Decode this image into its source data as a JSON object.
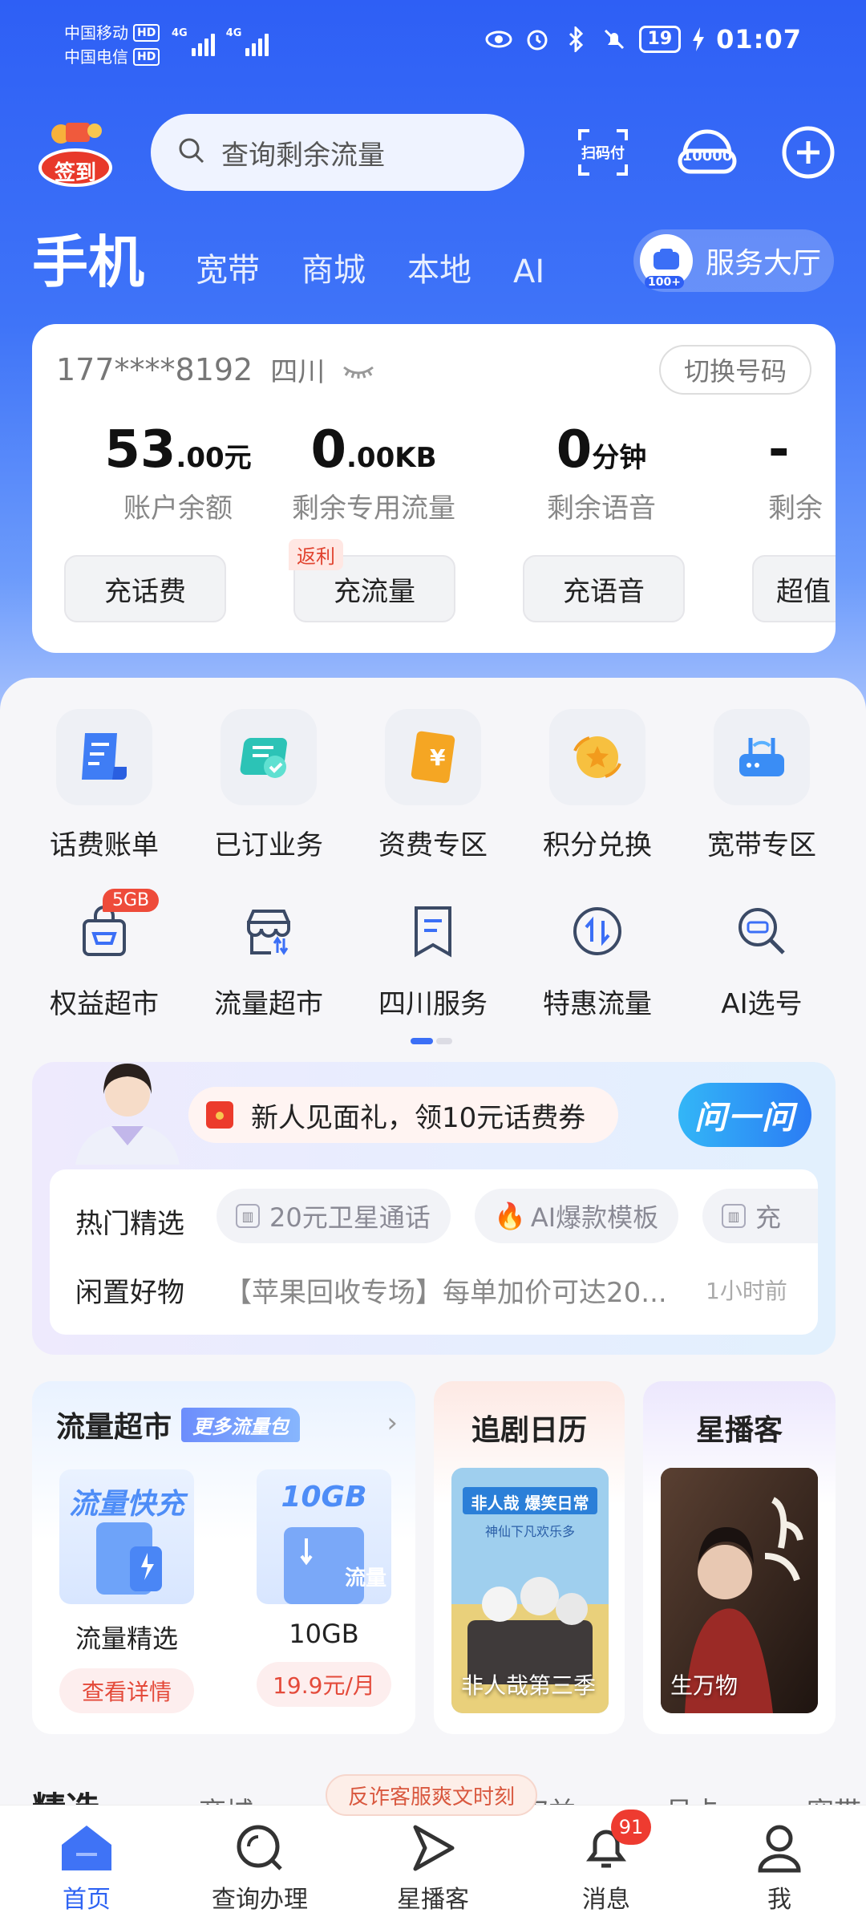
{
  "status_bar": {
    "carrier1": "中国移动",
    "carrier2": "中国电信",
    "hd": "HD",
    "net1": "4G",
    "net2": "4G",
    "battery": "19",
    "time": "01:07"
  },
  "header": {
    "signin_label": "签到",
    "search_placeholder": "查询剩余流量",
    "scan_pay_label": "扫码付",
    "hotline_label": "10000"
  },
  "tabs": [
    {
      "label": "手机",
      "active": true
    },
    {
      "label": "宽带"
    },
    {
      "label": "商城"
    },
    {
      "label": "本地"
    },
    {
      "label": "AI"
    }
  ],
  "service_hall": {
    "label": "服务大厅",
    "badge": "100+"
  },
  "account": {
    "phone": "177****8192",
    "province": "四川",
    "switch_label": "切换号码",
    "stats": [
      {
        "int": "53",
        "dec": ".00",
        "unit": "元",
        "label": "账户余额",
        "button": "充话费"
      },
      {
        "int": "0",
        "dec": ".00",
        "unit": "KB",
        "label": "剩余专用流量",
        "button": "充流量"
      },
      {
        "int": "0",
        "dec": "",
        "unit": "分钟",
        "label": "剩余语音",
        "button": "充语音"
      },
      {
        "int": "-",
        "dec": "",
        "unit": "",
        "label": "剩余",
        "button": "超值"
      }
    ],
    "rebate_tag": "返利"
  },
  "services_row1": [
    {
      "label": "话费账单",
      "icon": "bill-icon"
    },
    {
      "label": "已订业务",
      "icon": "subscribed-icon"
    },
    {
      "label": "资费专区",
      "icon": "tariff-icon"
    },
    {
      "label": "积分兑换",
      "icon": "points-icon"
    },
    {
      "label": "宽带专区",
      "icon": "router-icon"
    }
  ],
  "services_row2": [
    {
      "label": "权益超市",
      "icon": "shopping-bag-icon"
    },
    {
      "label": "流量超市",
      "icon": "data-store-icon"
    },
    {
      "label": "四川服务",
      "icon": "bookmark-doc-icon"
    },
    {
      "label": "特惠流量",
      "icon": "updown-arrows-icon"
    },
    {
      "label": "AI选号",
      "icon": "ai-search-icon"
    }
  ],
  "badge_5gb": "5GB",
  "promo": {
    "gift_text": "新人见面礼，领10元话费券",
    "ask_label": "问一问",
    "hot_label": "热门精选",
    "chips": [
      "20元卫星通话",
      "AI爆款模板",
      "充"
    ],
    "resale_label": "闲置好物",
    "resale_text": "【苹果回收专场】每单加价可达20...",
    "resale_time": "1小时前"
  },
  "flow_market": {
    "title": "流量超市",
    "more_tag": "更多流量包",
    "products": [
      {
        "image_text": "流量快充",
        "name": "流量精选",
        "action": "查看详情"
      },
      {
        "image_text": "10GB",
        "image_sub": "流量",
        "name": "10GB",
        "action": "19.9元/月"
      }
    ]
  },
  "drama": {
    "title": "追剧日历",
    "poster_title": "非人哉第三季",
    "poster_banner": "非人哉 爆笑日常",
    "poster_sub": "神仙下凡欢乐多"
  },
  "star": {
    "title": "星播客",
    "poster_title": "生万物"
  },
  "peek_tabs": [
    "精选",
    "商城",
    "权益",
    "号卡",
    "宽带"
  ],
  "fraud_pill": "反诈客服爽文时刻",
  "bottom_nav": [
    {
      "label": "首页",
      "icon": "home-icon",
      "active": true
    },
    {
      "label": "查询办理",
      "icon": "query-icon"
    },
    {
      "label": "星播客",
      "icon": "play-icon"
    },
    {
      "label": "消息",
      "icon": "bell-icon"
    },
    {
      "label": "我",
      "icon": "user-icon"
    }
  ],
  "message_count": "91",
  "colors": {
    "primary": "#2e5ff5",
    "accent_red": "#ee3b30",
    "active_tab": "#2e63f3"
  }
}
